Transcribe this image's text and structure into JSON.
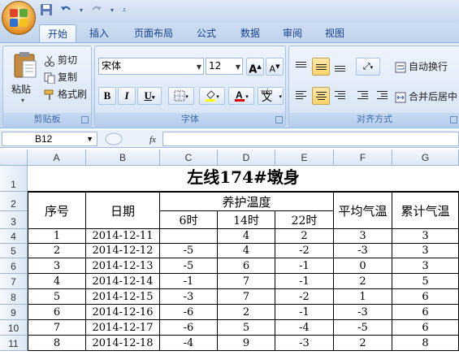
{
  "quick_access": {
    "save_icon": "save-icon",
    "undo_icon": "undo-icon",
    "redo_icon": "redo-icon",
    "customize_icon": "chevron-down-icon"
  },
  "tabs": [
    "开始",
    "插入",
    "页面布局",
    "公式",
    "数据",
    "审阅",
    "视图"
  ],
  "active_tab": "开始",
  "clipboard": {
    "paste": "粘贴",
    "cut": "剪切",
    "copy": "复制",
    "format_painter": "格式刷",
    "label": "剪贴板"
  },
  "font": {
    "name": "宋体",
    "size": "12",
    "grow": "A",
    "shrink": "A",
    "bold": "B",
    "italic": "I",
    "underline": "U",
    "phonetic": "wén",
    "phonetic_char": "文",
    "label": "字体"
  },
  "alignment": {
    "wrap_text": "自动换行",
    "merge_center": "合并后居中",
    "label": "对齐方式"
  },
  "formula_bar": {
    "name_box": "B12",
    "fx": "fx",
    "value": ""
  },
  "columns": [
    "A",
    "B",
    "C",
    "D",
    "E",
    "F",
    "G"
  ],
  "rows": [
    "1",
    "2",
    "3",
    "4",
    "5",
    "6",
    "7",
    "8",
    "9",
    "10",
    "11"
  ],
  "sheet": {
    "title": "左线174#墩身",
    "headers": {
      "seq": "序号",
      "date": "日期",
      "curing_temp": "养护温度",
      "t6": "6时",
      "t14": "14时",
      "t22": "22时",
      "avg": "平均气温",
      "cum": "累计气温"
    },
    "data": [
      [
        "1",
        "2014-12-11",
        "",
        "4",
        "2",
        "3",
        "3"
      ],
      [
        "2",
        "2014-12-12",
        "-5",
        "4",
        "-2",
        "-3",
        "3"
      ],
      [
        "3",
        "2014-12-13",
        "-5",
        "6",
        "-1",
        "0",
        "3"
      ],
      [
        "4",
        "2014-12-14",
        "-1",
        "7",
        "-1",
        "2",
        "5"
      ],
      [
        "5",
        "2014-12-15",
        "-3",
        "7",
        "-2",
        "1",
        "6"
      ],
      [
        "6",
        "2014-12-16",
        "-6",
        "2",
        "-1",
        "-3",
        "6"
      ],
      [
        "7",
        "2014-12-17",
        "-6",
        "5",
        "-4",
        "-5",
        "6"
      ],
      [
        "8",
        "2014-12-18",
        "-4",
        "9",
        "-3",
        "2",
        "8"
      ]
    ]
  },
  "colors": {
    "ribbon_bg": "#d3e1f3",
    "tab_text": "#15428b",
    "group_label": "#3e6aaa",
    "selected_align": "#ffd36b"
  }
}
